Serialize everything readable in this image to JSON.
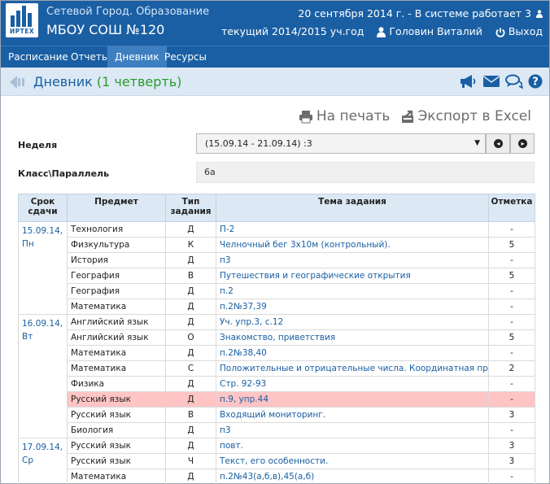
{
  "header": {
    "logo_text": "ИРТЕХ",
    "app_title": "Сетевой Город. Образование",
    "school": "МБОУ СОШ №120",
    "status_line": "20 сентября 2014 г. - В системе работает 3",
    "year": "текущий 2014/2015 уч.год",
    "user": "Головин Виталий",
    "logout": "Выход"
  },
  "nav": {
    "items": [
      {
        "label": "Расписание"
      },
      {
        "label": "Отчеты"
      },
      {
        "label": "Дневник"
      },
      {
        "label": "Ресурсы"
      }
    ],
    "active": "Дневник"
  },
  "page": {
    "title": "Дневник",
    "quarter": "(1 четверть)",
    "icons": [
      "megaphone-icon",
      "mail-icon",
      "chat-icon",
      "help-icon"
    ]
  },
  "actions": {
    "print": "На печать",
    "export": "Экспорт в Excel"
  },
  "filters": {
    "week_label": "Неделя",
    "week_value": "(15.09.14 - 21.09.14) :3",
    "class_label": "Класс\\Параллель",
    "class_value": "6а"
  },
  "table": {
    "headers": {
      "date": "Срок сдачи",
      "subject": "Предмет",
      "type": "Тип задания",
      "topic": "Тема задания",
      "mark": "Отметка"
    },
    "groups": [
      {
        "date": "15.09.14,",
        "day": "Пн",
        "rows": [
          {
            "subject": "Технология",
            "type": "Д",
            "topic": "П-2",
            "mark": "-"
          },
          {
            "subject": "Физкультура",
            "type": "К",
            "topic": "Челночный бег 3х10м (контрольный).",
            "mark": "5"
          },
          {
            "subject": "История",
            "type": "Д",
            "topic": "п3",
            "mark": "-"
          },
          {
            "subject": "География",
            "type": "В",
            "topic": "Путешествия и географические открытия",
            "mark": "5"
          },
          {
            "subject": "География",
            "type": "Д",
            "topic": "п.2",
            "mark": "-"
          },
          {
            "subject": "Математика",
            "type": "Д",
            "topic": "п.2№37,39",
            "mark": "-"
          }
        ]
      },
      {
        "date": "16.09.14,",
        "day": "Вт",
        "rows": [
          {
            "subject": "Английский язык",
            "type": "Д",
            "topic": "Уч. упр.3, с.12",
            "mark": "-"
          },
          {
            "subject": "Английский язык",
            "type": "О",
            "topic": "Знакомство, приветствия",
            "mark": "5"
          },
          {
            "subject": "Математика",
            "type": "Д",
            "topic": "п.2№38,40",
            "mark": "-"
          },
          {
            "subject": "Математика",
            "type": "С",
            "topic": "Положительные и отрицательные числа. Координатная прямая",
            "mark": "2"
          },
          {
            "subject": "Физика",
            "type": "Д",
            "topic": "Стр. 92-93",
            "mark": "-"
          },
          {
            "subject": "Русский язык",
            "type": "Д",
            "topic": "п.9, упр.44",
            "mark": "-",
            "highlight": true
          },
          {
            "subject": "Русский язык",
            "type": "В",
            "topic": "Входящий мониторинг.",
            "mark": "3"
          },
          {
            "subject": "Биология",
            "type": "Д",
            "topic": "п3",
            "mark": "-"
          }
        ]
      },
      {
        "date": "17.09.14,",
        "day": "Ср",
        "rows": [
          {
            "subject": "Русский язык",
            "type": "Д",
            "topic": "повт.",
            "mark": "3"
          },
          {
            "subject": "Русский язык",
            "type": "Ч",
            "topic": "Текст, его особенности.",
            "mark": "3"
          },
          {
            "subject": "Математика",
            "type": "Д",
            "topic": "п.2№43(а,б,в),45(а,б)",
            "mark": "-"
          }
        ]
      }
    ]
  },
  "colors": {
    "brand": "#1a5fa3",
    "highlight_row": "#ffc4c4",
    "quarter_text": "#2a9a2a"
  }
}
